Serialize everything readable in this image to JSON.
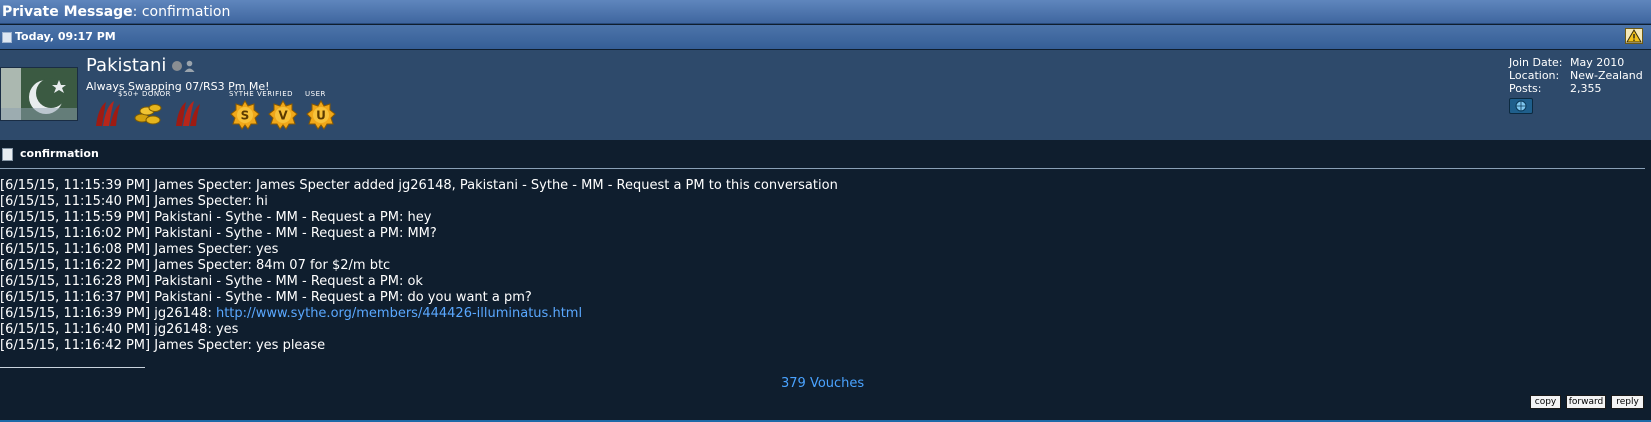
{
  "header": {
    "title_prefix": "Private Message",
    "title_separator": ":",
    "title": "confirmation"
  },
  "post": {
    "date": "Today, 09:17 PM",
    "warn_icon": "warning-triangle-icon"
  },
  "user": {
    "name": "Pakistani",
    "title": "Always Swapping 07/RS3 Pm Me!",
    "badges": {
      "donor_label": "$50+ DONOR",
      "sythe_label": "SYTHE",
      "verified_label": "VERIFIED",
      "user_label": "USER"
    },
    "info": [
      {
        "key": "Join Date:",
        "value": "May 2010"
      },
      {
        "key": "Location:",
        "value": "New-Zealand"
      },
      {
        "key": "Posts:",
        "value": "2,355"
      }
    ]
  },
  "message": {
    "title": "confirmation",
    "lines": [
      {
        "text": "[6/15/15, 11:15:39 PM] James Specter: James Specter added jg26148, Pakistani - Sythe - MM - Request a PM to this conversation"
      },
      {
        "text": "[6/15/15, 11:15:40 PM] James Specter: hi"
      },
      {
        "text": "[6/15/15, 11:15:59 PM] Pakistani - Sythe - MM - Request a PM: hey"
      },
      {
        "text": "[6/15/15, 11:16:02 PM] Pakistani - Sythe - MM - Request a PM: MM?"
      },
      {
        "text": "[6/15/15, 11:16:08 PM] James Specter: yes"
      },
      {
        "text": "[6/15/15, 11:16:22 PM] James Specter: 84m 07 for $2/m btc"
      },
      {
        "text": "[6/15/15, 11:16:28 PM] Pakistani - Sythe - MM - Request a PM: ok"
      },
      {
        "text": "[6/15/15, 11:16:37 PM] Pakistani - Sythe - MM - Request a PM: do you want a pm?"
      },
      {
        "text": "[6/15/15, 11:16:39 PM] jg26148: ",
        "link": "http://www.sythe.org/members/444426-illuminatus.html"
      },
      {
        "text": "[6/15/15, 11:16:40 PM] jg26148: yes"
      },
      {
        "text": "[6/15/15, 11:16:42 PM] James Specter: yes please"
      }
    ]
  },
  "signature": {
    "vouches": "379 Vouches"
  },
  "actions": {
    "copy": "copy",
    "forward": "forward",
    "reply": "reply"
  },
  "colors": {
    "link": "#5aa8ff",
    "header_blue": "#3f669f",
    "user_bar": "#2e4a6b",
    "body_bg": "#0f1e2e"
  }
}
